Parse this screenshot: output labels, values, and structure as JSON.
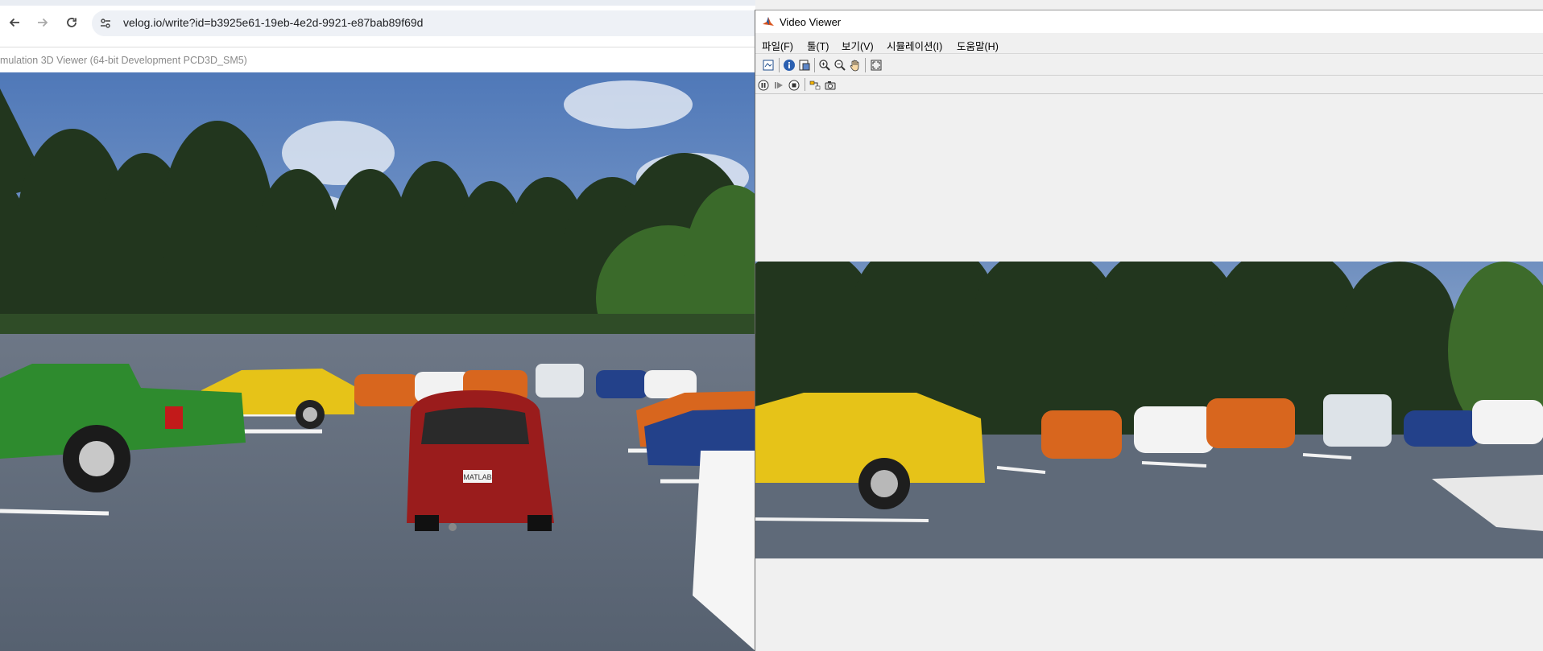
{
  "browser": {
    "back_icon": "arrow-left-icon",
    "forward_icon": "arrow-right-icon",
    "reload_icon": "reload-icon",
    "site_info_icon": "site-settings-icon",
    "url": "velog.io/write?id=b3925e61-19eb-4e2d-9921-e87bab89f69d"
  },
  "sim_window": {
    "title": "mulation 3D Viewer (64-bit Development PCD3D_SM5)",
    "license_plate": "MATLAB"
  },
  "video_viewer": {
    "title": "Video Viewer",
    "logo_icon": "matlab-logo-icon",
    "menu": [
      {
        "label": "파일(F)"
      },
      {
        "label": "툴(T)"
      },
      {
        "label": "보기(V)"
      },
      {
        "label": "시뮬레이션(I)"
      },
      {
        "label": "도움말(H)"
      }
    ],
    "toolbar_icons": [
      "print-to-figure-icon",
      "info-icon",
      "export-icon",
      "zoom-in-icon",
      "zoom-out-icon",
      "pan-hand-icon",
      "fit-to-window-icon"
    ],
    "playback_icons": [
      "pause-icon",
      "step-forward-icon",
      "stop-icon",
      "highlight-simulink-icon",
      "snapshot-camera-icon"
    ]
  },
  "colors": {
    "sky_top": "#4f78b8",
    "sky_bottom": "#b9cbe2",
    "asphalt": "#5d6878",
    "tree_dark": "#21351d",
    "car_red": "#9a1c1c",
    "car_green": "#2e8b2e",
    "car_yellow": "#e6c318",
    "car_orange": "#d8661e"
  }
}
